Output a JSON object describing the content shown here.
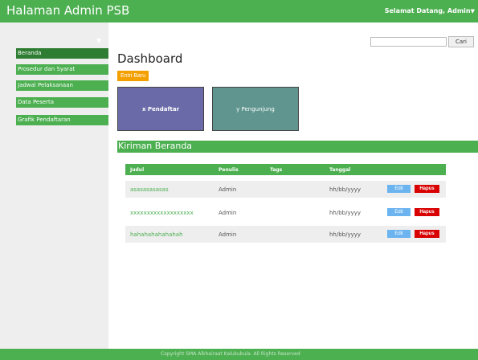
{
  "header": {
    "app_title": "Halaman Admin PSB",
    "welcome": "Selamat Datang, Admin",
    "welcome_caret": "▼"
  },
  "sidebar": {
    "caret": "▼",
    "items": [
      {
        "label": "Beranda",
        "active": true
      },
      {
        "label": "Prosedur dan Syarat",
        "active": false
      },
      {
        "label": "Jadwal Pelaksanaan",
        "active": false
      },
      {
        "label": "Data Peserta",
        "active": false
      },
      {
        "label": "Grafik Pendaftaran",
        "active": false
      }
    ]
  },
  "search": {
    "value": "",
    "placeholder": "",
    "button_label": "Cari"
  },
  "main": {
    "page_title": "Dashboard",
    "entri_button": "Entri Baru",
    "stats": {
      "pendaftar": "x Pendaftar",
      "pengunjung": "y Pengunjung"
    },
    "section_title": "Kiriman Beranda",
    "table": {
      "headers": [
        "Judul",
        "Penulis",
        "Tags",
        "Tanggal"
      ],
      "rows": [
        {
          "judul": "asasasasasas",
          "penulis": "Admin",
          "tags": "",
          "tanggal": "hh/bb/yyyy"
        },
        {
          "judul": "xxxxxxxxxxxxxxxxxxx",
          "penulis": "Admin",
          "tags": "",
          "tanggal": "hh/bb/yyyy"
        },
        {
          "judul": "hahahahahahahah",
          "penulis": "Admin",
          "tags": "",
          "tanggal": "hh/bb/yyyy"
        }
      ],
      "edit_label": "Edit",
      "delete_label": "Hapus"
    }
  },
  "footer": {
    "text": "Copyright SMA Alkhairaat Kalukubula. All Rights Reserved"
  },
  "colors": {
    "primary": "#4caf50",
    "active": "#2e7d32",
    "accent": "#f4a000",
    "edit": "#6cb4f0",
    "delete": "#d80000"
  }
}
